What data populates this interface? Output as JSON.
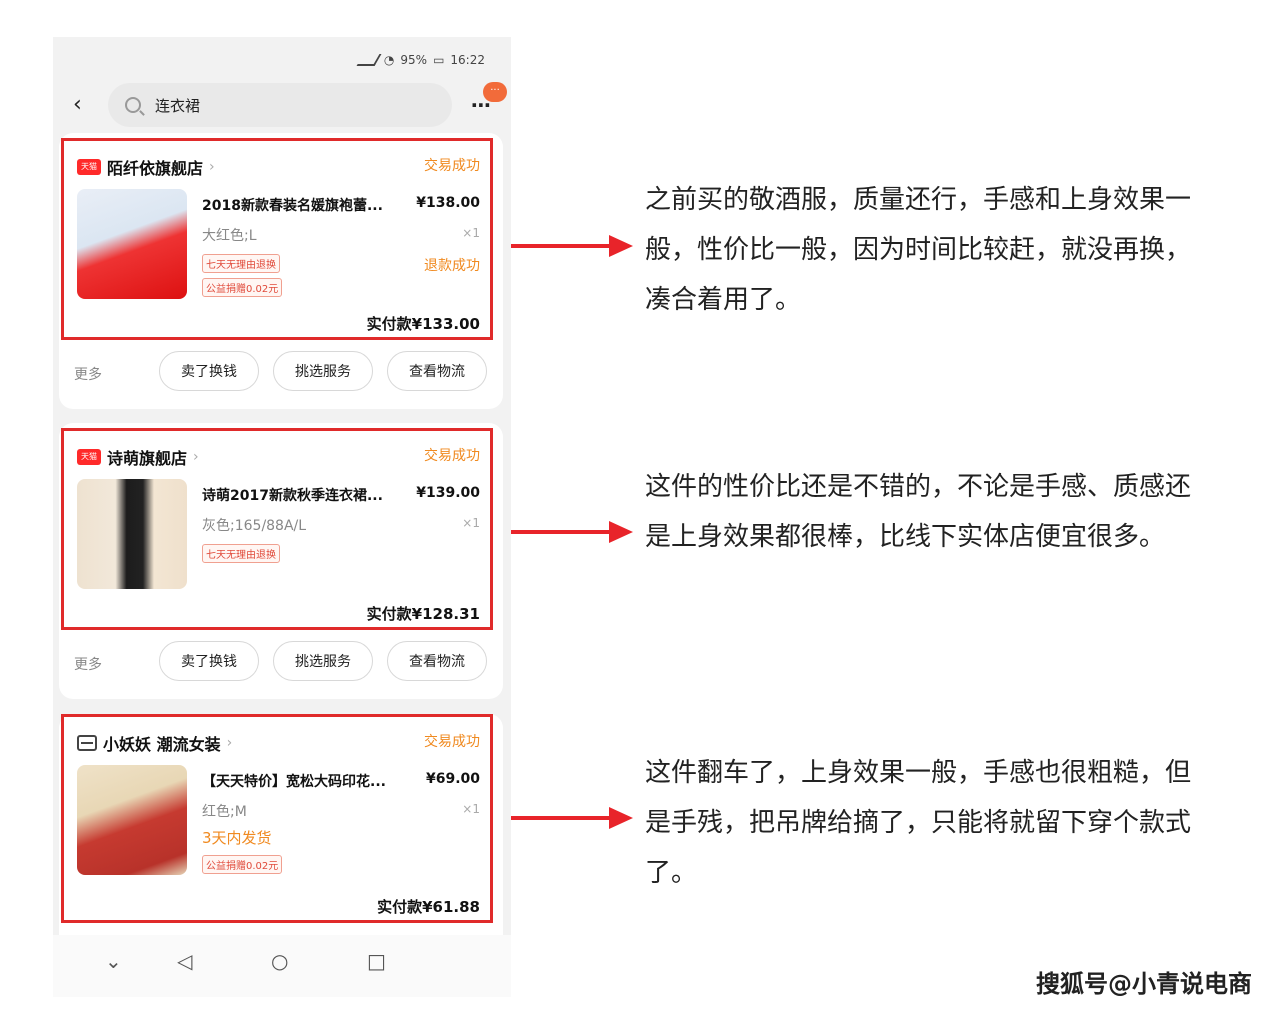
{
  "status_bar": {
    "battery": "95%",
    "time": "16:22"
  },
  "search": {
    "query": "连衣裙"
  },
  "badge": "···",
  "orders": [
    {
      "shop_name": "陌纤依旗舰店",
      "shop_logo": "天猫",
      "status": "交易成功",
      "title": "2018新款春装名媛旗袍蕾...",
      "price": "¥138.00",
      "spec": "大红色;L",
      "qty": "×1",
      "tags": [
        "七天无理由退换",
        "公益捐赠0.02元"
      ],
      "refund": "退款成功",
      "paid": "实付款¥133.00"
    },
    {
      "shop_name": "诗萌旗舰店",
      "shop_logo": "天猫",
      "status": "交易成功",
      "title": "诗萌2017新款秋季连衣裙...",
      "price": "¥139.00",
      "spec": "灰色;165/88A/L",
      "qty": "×1",
      "tags": [
        "七天无理由退换"
      ],
      "paid": "实付款¥128.31"
    },
    {
      "shop_name": "小妖妖 潮流女装",
      "status": "交易成功",
      "title": "【天天特价】宽松大码印花...",
      "price": "¥69.00",
      "spec": "红色;M",
      "qty": "×1",
      "shipping": "3天内发货",
      "tags": [
        "公益捐赠0.02元"
      ],
      "paid": "实付款¥61.88"
    }
  ],
  "actions": {
    "more": "更多",
    "sell": "卖了换钱",
    "service": "挑选服务",
    "logistics": "查看物流"
  },
  "nav": {
    "down": "⌄",
    "back": "◁",
    "home": "○",
    "recent": "□"
  },
  "notes": [
    "之前买的敬酒服，质量还行，手感和上身效果一般，性价比一般，因为时间比较赶，就没再换，凑合着用了。",
    "这件的性价比还是不错的，不论是手感、质感还是上身效果都很棒，比线下实体店便宜很多。",
    "这件翻车了，上身效果一般，手感也很粗糙，但是手残，把吊牌给摘了，只能将就留下穿个款式了。"
  ],
  "watermark": "搜狐号@小青说电商",
  "colors": {
    "highlight_box": "#e02a2a",
    "arrow": "#e8242a",
    "status": "#f08a20"
  }
}
